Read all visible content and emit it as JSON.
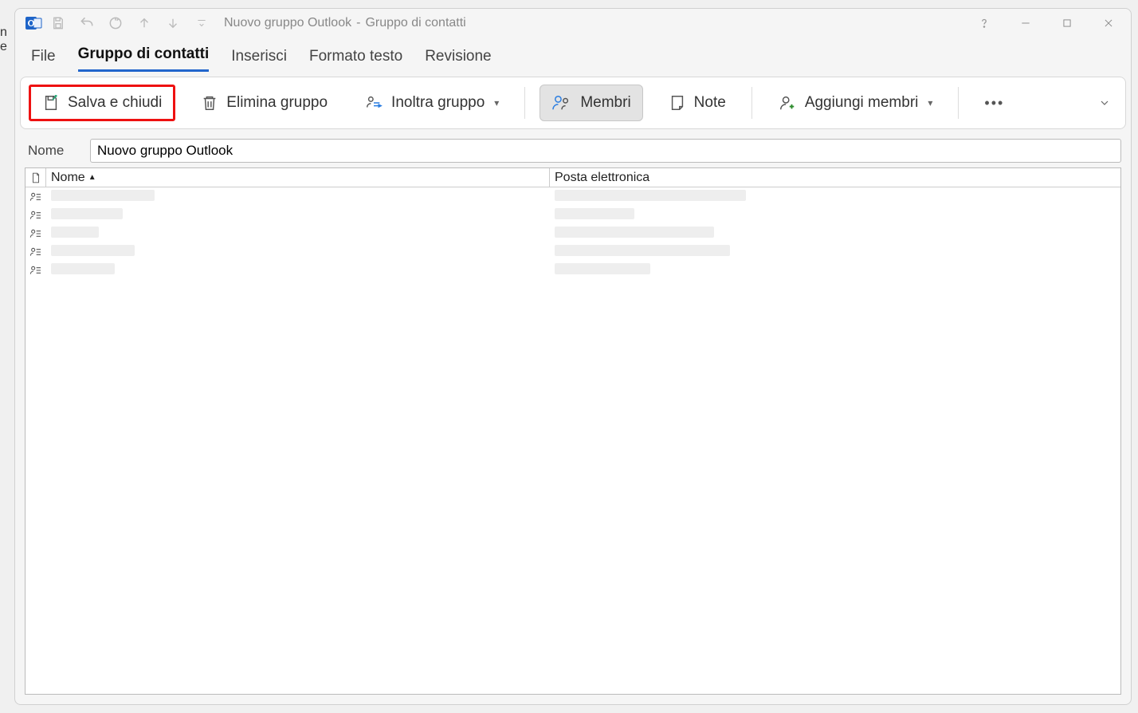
{
  "window": {
    "title_doc": "Nuovo gruppo Outlook",
    "title_sep": "  -  ",
    "title_sub": "Gruppo di contatti"
  },
  "tabs": {
    "file": "File",
    "gruppo": "Gruppo di contatti",
    "inserisci": "Inserisci",
    "formato": "Formato testo",
    "revisione": "Revisione"
  },
  "ribbon": {
    "salva": "Salva e chiudi",
    "elimina": "Elimina gruppo",
    "inoltra": "Inoltra gruppo",
    "membri": "Membri",
    "note": "Note",
    "aggiungi": "Aggiungi membri"
  },
  "form": {
    "name_label": "Nome",
    "name_value": "Nuovo gruppo Outlook"
  },
  "grid": {
    "col_nome": "Nome",
    "col_email": "Posta elettronica",
    "rows": [
      {
        "name": "",
        "email": ""
      },
      {
        "name": "",
        "email": ""
      },
      {
        "name": "",
        "email": ""
      },
      {
        "name": "",
        "email": ""
      },
      {
        "name": "",
        "email": ""
      }
    ]
  }
}
